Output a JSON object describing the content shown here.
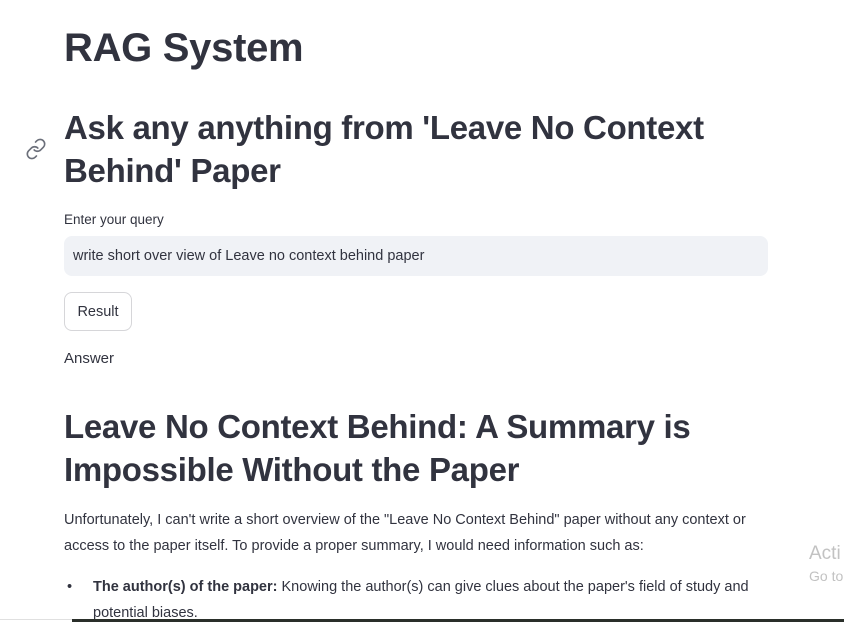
{
  "app": {
    "title": "RAG System"
  },
  "subheader": {
    "text": "Ask any anything from 'Leave No Context Behind' Paper",
    "anchor_icon": "link-icon"
  },
  "query": {
    "label": "Enter your query",
    "value": "write short over view of Leave no context behind paper"
  },
  "result_button": {
    "label": "Result"
  },
  "answer": {
    "label": "Answer",
    "heading": "Leave No Context Behind: A Summary is Impossible Without the Paper",
    "paragraph": "Unfortunately, I can't write a short overview of the \"Leave No Context Behind\" paper without any context or access to the paper itself. To provide a proper summary, I would need information such as:",
    "bullets": [
      {
        "bold": "The author(s) of the paper:",
        "text": " Knowing the author(s) can give clues about the paper's field of study and potential biases."
      }
    ]
  },
  "watermark": {
    "line1": "Acti",
    "line2": "Go to"
  },
  "colors": {
    "text": "#31333f",
    "input_bg": "#f0f2f6",
    "button_border": "#d6d6d9",
    "watermark": "#c2c2c2"
  }
}
